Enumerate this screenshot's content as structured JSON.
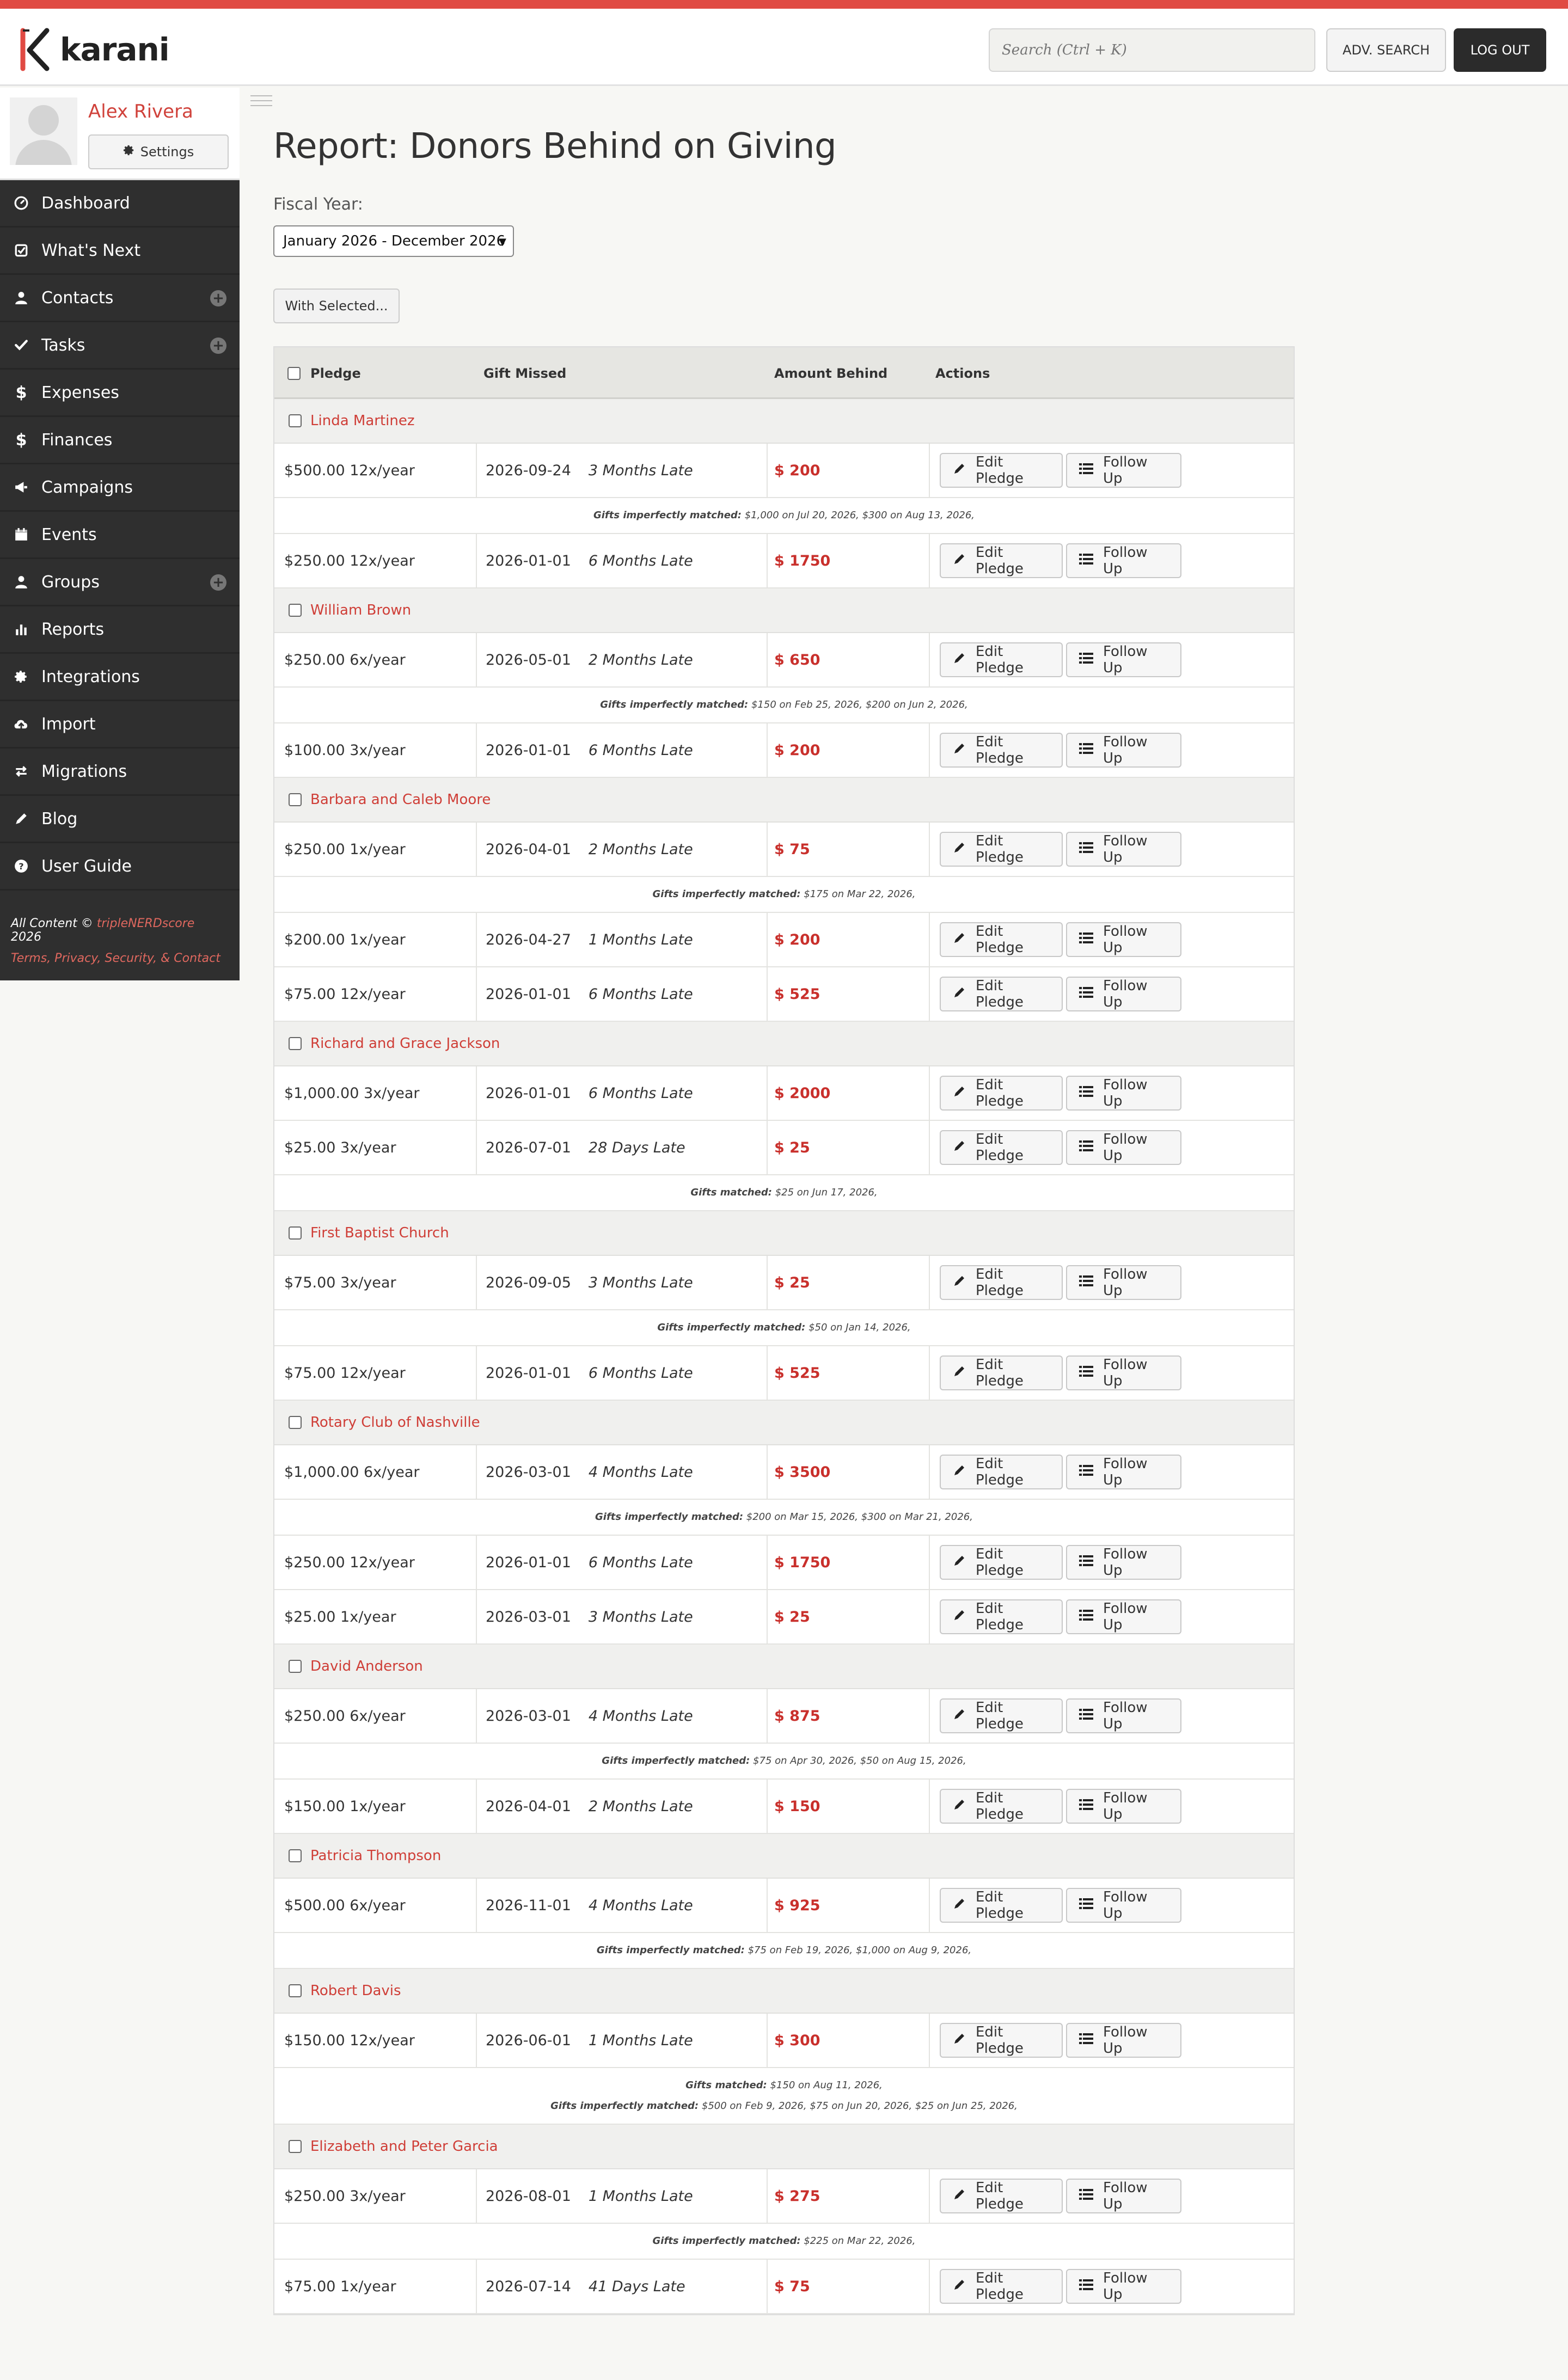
{
  "app": {
    "name": "karani",
    "search_placeholder": "Search (Ctrl + K)",
    "adv_search": "ADV. SEARCH",
    "logout": "LOG OUT"
  },
  "user": {
    "name": "Alex Rivera",
    "settings": "Settings"
  },
  "nav": [
    {
      "label": "Dashboard",
      "icon": "dashboard-icon",
      "plus": false
    },
    {
      "label": "What's Next",
      "icon": "checklist-icon",
      "plus": false
    },
    {
      "label": "Contacts",
      "icon": "user-icon",
      "plus": true
    },
    {
      "label": "Tasks",
      "icon": "check-icon",
      "plus": true
    },
    {
      "label": "Expenses",
      "icon": "dollar-icon",
      "plus": false
    },
    {
      "label": "Finances",
      "icon": "dollar-icon",
      "plus": false
    },
    {
      "label": "Campaigns",
      "icon": "megaphone-icon",
      "plus": false
    },
    {
      "label": "Events",
      "icon": "calendar-icon",
      "plus": false
    },
    {
      "label": "Groups",
      "icon": "user-icon",
      "plus": true
    },
    {
      "label": "Reports",
      "icon": "bar-chart-icon",
      "plus": false
    },
    {
      "label": "Integrations",
      "icon": "gear-icon",
      "plus": false
    },
    {
      "label": "Import",
      "icon": "cloud-upload-icon",
      "plus": false
    },
    {
      "label": "Migrations",
      "icon": "exchange-icon",
      "plus": false
    },
    {
      "label": "Blog",
      "icon": "pencil-icon",
      "plus": false
    },
    {
      "label": "User Guide",
      "icon": "question-icon",
      "plus": false
    }
  ],
  "footer": {
    "prefix": "All Content © ",
    "brand": "tripleNERDscore",
    "year": " 2026",
    "links": "Terms, Privacy, Security, & Contact"
  },
  "page": {
    "title": "Report: Donors Behind on Giving",
    "fiscal_label": "Fiscal Year:",
    "fiscal_value": "January 2026 - December 2026",
    "with_selected": "With Selected..."
  },
  "table": {
    "headers": {
      "pledge": "Pledge",
      "gift_missed": "Gift Missed",
      "amount_behind": "Amount Behind",
      "actions": "Actions"
    },
    "edit_label": "Edit Pledge",
    "follow_label": "Follow Up",
    "rows": [
      {
        "type": "donor",
        "name": "Linda Martinez"
      },
      {
        "type": "pledge",
        "pledge": "$500.00 12x/year",
        "date": "2026-09-24",
        "late": "3 Months Late",
        "amount": "$ 200"
      },
      {
        "type": "note",
        "lines": [
          {
            "label": "Gifts imperfectly matched:",
            "text": " $1,000 on Jul 20, 2026, $300 on Aug 13, 2026,"
          }
        ]
      },
      {
        "type": "pledge",
        "pledge": "$250.00 12x/year",
        "date": "2026-01-01",
        "late": "6 Months Late",
        "amount": "$ 1750"
      },
      {
        "type": "donor",
        "name": "William Brown"
      },
      {
        "type": "pledge",
        "pledge": "$250.00 6x/year",
        "date": "2026-05-01",
        "late": "2 Months Late",
        "amount": "$ 650"
      },
      {
        "type": "note",
        "lines": [
          {
            "label": "Gifts imperfectly matched:",
            "text": " $150 on Feb 25, 2026, $200 on Jun 2, 2026,"
          }
        ]
      },
      {
        "type": "pledge",
        "pledge": "$100.00 3x/year",
        "date": "2026-01-01",
        "late": "6 Months Late",
        "amount": "$ 200"
      },
      {
        "type": "donor",
        "name": "Barbara and Caleb Moore"
      },
      {
        "type": "pledge",
        "pledge": "$250.00 1x/year",
        "date": "2026-04-01",
        "late": "2 Months Late",
        "amount": "$ 75"
      },
      {
        "type": "note",
        "lines": [
          {
            "label": "Gifts imperfectly matched:",
            "text": " $175 on Mar 22, 2026,"
          }
        ]
      },
      {
        "type": "pledge",
        "pledge": "$200.00 1x/year",
        "date": "2026-04-27",
        "late": "1 Months Late",
        "amount": "$ 200"
      },
      {
        "type": "pledge",
        "pledge": "$75.00 12x/year",
        "date": "2026-01-01",
        "late": "6 Months Late",
        "amount": "$ 525"
      },
      {
        "type": "donor",
        "name": "Richard and Grace Jackson"
      },
      {
        "type": "pledge",
        "pledge": "$1,000.00 3x/year",
        "date": "2026-01-01",
        "late": "6 Months Late",
        "amount": "$ 2000"
      },
      {
        "type": "pledge",
        "pledge": "$25.00 3x/year",
        "date": "2026-07-01",
        "late": "28 Days Late",
        "amount": "$ 25"
      },
      {
        "type": "note",
        "lines": [
          {
            "label": "Gifts matched:",
            "text": " $25 on Jun 17, 2026,"
          }
        ]
      },
      {
        "type": "donor",
        "name": "First Baptist Church"
      },
      {
        "type": "pledge",
        "pledge": "$75.00 3x/year",
        "date": "2026-09-05",
        "late": "3 Months Late",
        "amount": "$ 25"
      },
      {
        "type": "note",
        "lines": [
          {
            "label": "Gifts imperfectly matched:",
            "text": " $50 on Jan 14, 2026,"
          }
        ]
      },
      {
        "type": "pledge",
        "pledge": "$75.00 12x/year",
        "date": "2026-01-01",
        "late": "6 Months Late",
        "amount": "$ 525"
      },
      {
        "type": "donor",
        "name": "Rotary Club of Nashville"
      },
      {
        "type": "pledge",
        "pledge": "$1,000.00 6x/year",
        "date": "2026-03-01",
        "late": "4 Months Late",
        "amount": "$ 3500"
      },
      {
        "type": "note",
        "lines": [
          {
            "label": "Gifts imperfectly matched:",
            "text": " $200 on Mar 15, 2026, $300 on Mar 21, 2026,"
          }
        ]
      },
      {
        "type": "pledge",
        "pledge": "$250.00 12x/year",
        "date": "2026-01-01",
        "late": "6 Months Late",
        "amount": "$ 1750"
      },
      {
        "type": "pledge",
        "pledge": "$25.00 1x/year",
        "date": "2026-03-01",
        "late": "3 Months Late",
        "amount": "$ 25"
      },
      {
        "type": "donor",
        "name": "David Anderson"
      },
      {
        "type": "pledge",
        "pledge": "$250.00 6x/year",
        "date": "2026-03-01",
        "late": "4 Months Late",
        "amount": "$ 875"
      },
      {
        "type": "note",
        "lines": [
          {
            "label": "Gifts imperfectly matched:",
            "text": " $75 on Apr 30, 2026, $50 on Aug 15, 2026,"
          }
        ]
      },
      {
        "type": "pledge",
        "pledge": "$150.00 1x/year",
        "date": "2026-04-01",
        "late": "2 Months Late",
        "amount": "$ 150"
      },
      {
        "type": "donor",
        "name": "Patricia Thompson"
      },
      {
        "type": "pledge",
        "pledge": "$500.00 6x/year",
        "date": "2026-11-01",
        "late": "4 Months Late",
        "amount": "$ 925"
      },
      {
        "type": "note",
        "lines": [
          {
            "label": "Gifts imperfectly matched:",
            "text": " $75 on Feb 19, 2026, $1,000 on Aug 9, 2026,"
          }
        ]
      },
      {
        "type": "donor",
        "name": "Robert Davis"
      },
      {
        "type": "pledge",
        "pledge": "$150.00 12x/year",
        "date": "2026-06-01",
        "late": "1 Months Late",
        "amount": "$ 300"
      },
      {
        "type": "note",
        "lines": [
          {
            "label": "Gifts matched:",
            "text": " $150 on Aug 11, 2026,"
          },
          {
            "label": "Gifts imperfectly matched:",
            "text": " $500 on Feb 9, 2026, $75 on Jun 20, 2026, $25 on Jun 25, 2026,"
          }
        ]
      },
      {
        "type": "donor",
        "name": "Elizabeth and Peter Garcia"
      },
      {
        "type": "pledge",
        "pledge": "$250.00 3x/year",
        "date": "2026-08-01",
        "late": "1 Months Late",
        "amount": "$ 275"
      },
      {
        "type": "note",
        "lines": [
          {
            "label": "Gifts imperfectly matched:",
            "text": " $225 on Mar 22, 2026,"
          }
        ]
      },
      {
        "type": "pledge",
        "pledge": "$75.00 1x/year",
        "date": "2026-07-14",
        "late": "41 Days Late",
        "amount": "$ 75"
      }
    ]
  },
  "colors": {
    "accent": "#e04a43",
    "link": "#cf3e37",
    "sidebar": "#2f2f2f"
  }
}
